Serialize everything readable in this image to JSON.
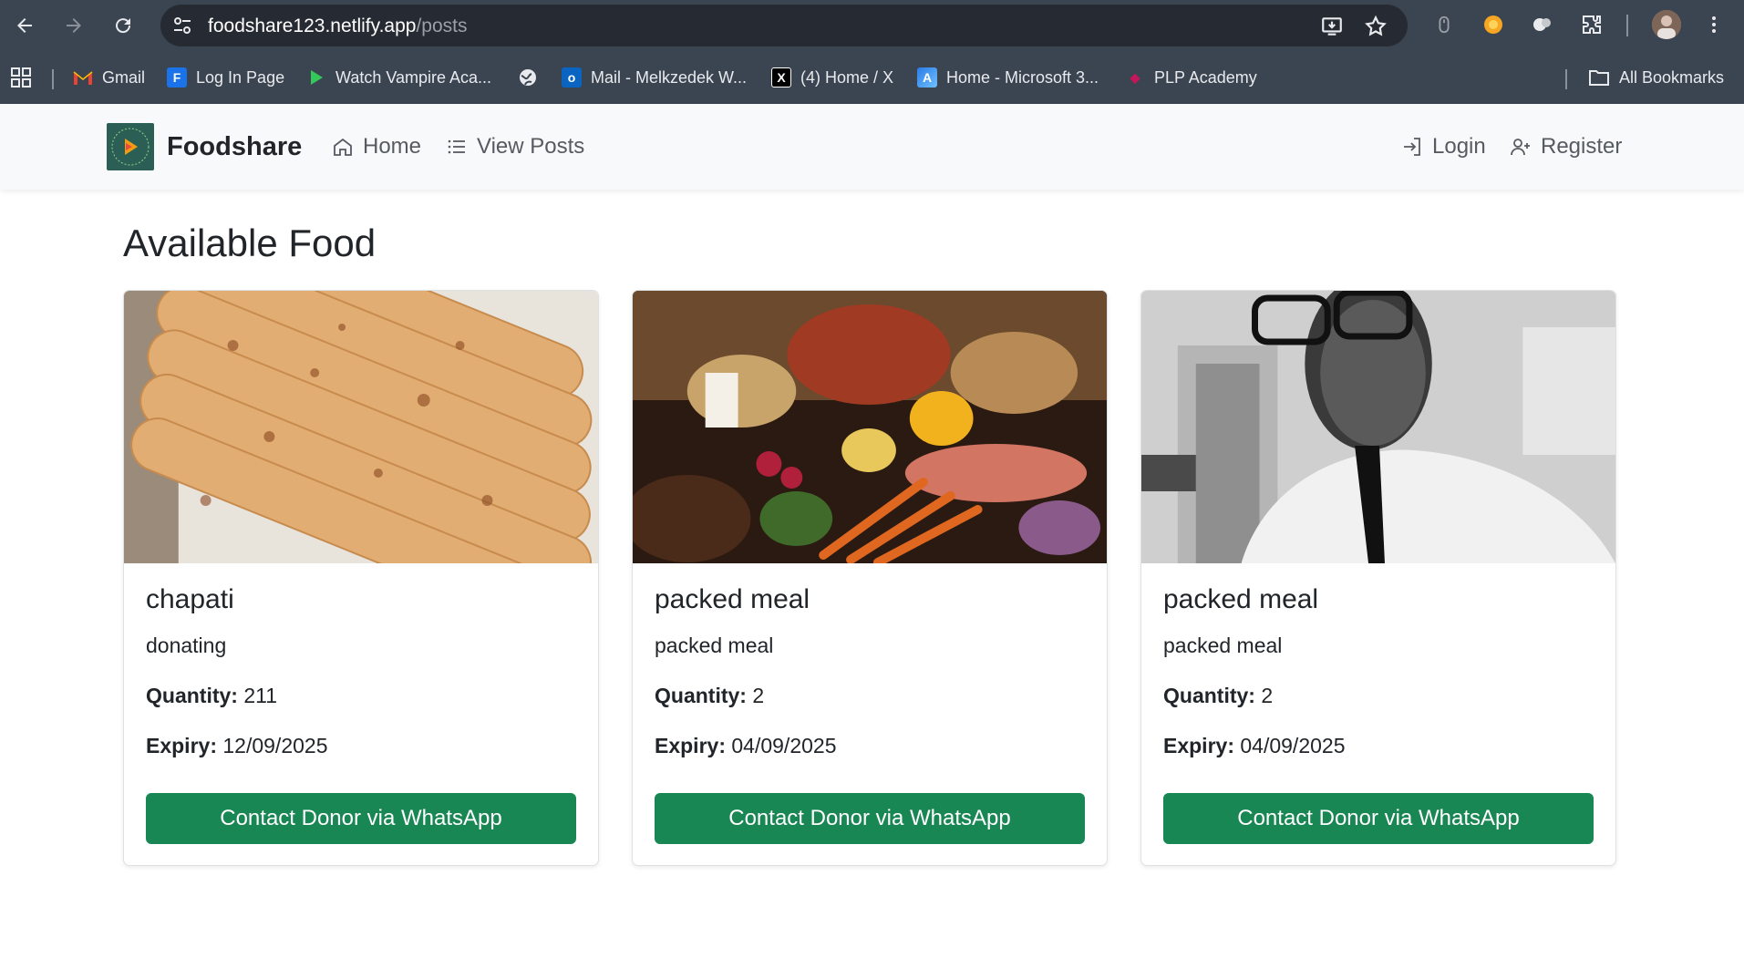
{
  "browser": {
    "url_host": "foodshare123.netlify.app",
    "url_path": "/posts",
    "bookmarks": [
      {
        "label": "Gmail",
        "icon": "gmail-icon"
      },
      {
        "label": "Log In Page",
        "icon": "login-page-icon"
      },
      {
        "label": "Watch Vampire Aca...",
        "icon": "play-icon"
      },
      {
        "label": "",
        "icon": "globe-icon"
      },
      {
        "label": "Mail - Melkzedek W...",
        "icon": "outlook-icon"
      },
      {
        "label": "(4) Home / X",
        "icon": "x-icon"
      },
      {
        "label": "Home - Microsoft 3...",
        "icon": "microsoft-icon"
      },
      {
        "label": "PLP Academy",
        "icon": "plp-icon"
      }
    ],
    "all_bookmarks": "All Bookmarks"
  },
  "site": {
    "brand": "Foodshare",
    "nav": {
      "home": "Home",
      "view_posts": "View Posts",
      "login": "Login",
      "register": "Register"
    }
  },
  "main": {
    "title": "Available Food",
    "field_labels": {
      "quantity": "Quantity:",
      "expiry": "Expiry:"
    },
    "posts": [
      {
        "title": "chapati",
        "description": "donating",
        "quantity": "211",
        "expiry": "12/09/2025",
        "button": "Contact Donor via WhatsApp",
        "image": "chapati-photo"
      },
      {
        "title": "packed meal",
        "description": "packed meal",
        "quantity": "2",
        "expiry": "04/09/2025",
        "button": "Contact Donor via WhatsApp",
        "image": "assorted-food-photo"
      },
      {
        "title": "packed meal",
        "description": "packed meal",
        "quantity": "2",
        "expiry": "04/09/2025",
        "button": "Contact Donor via WhatsApp",
        "image": "man-portrait-photo"
      }
    ]
  },
  "colors": {
    "chrome_bg": "#3b4451",
    "navbar_bg": "#f8f9fa",
    "button_green": "#198754",
    "brand_logo_bg": "#2b5f55"
  }
}
